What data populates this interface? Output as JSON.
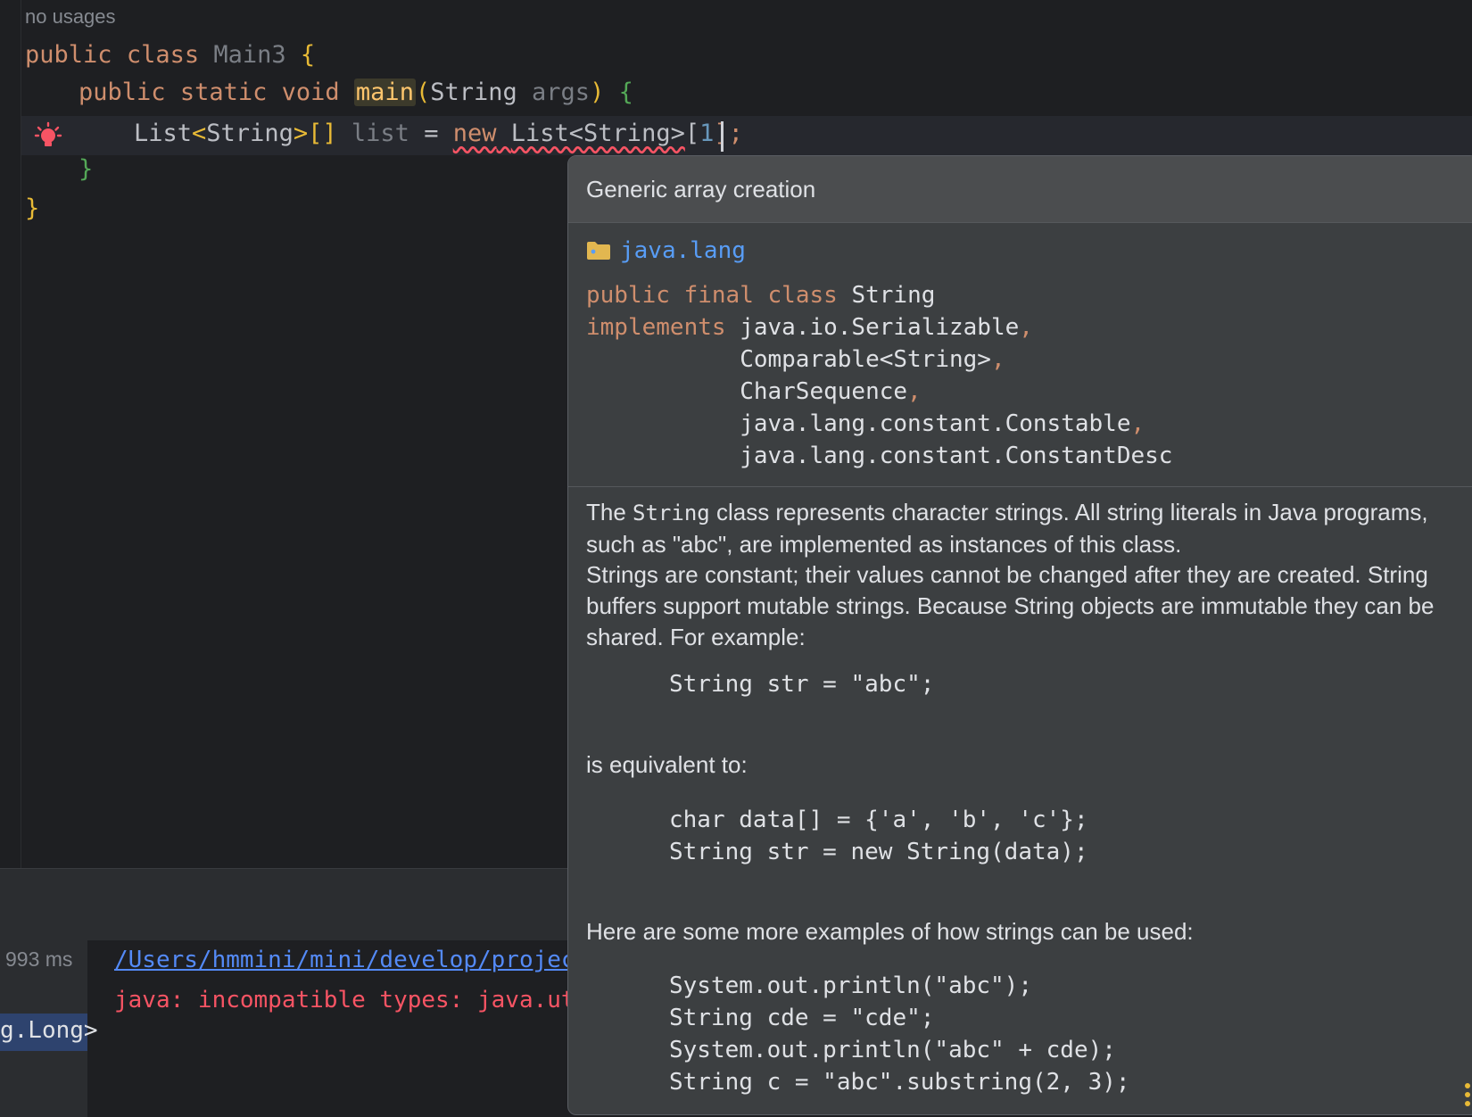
{
  "editor": {
    "usage_hint": "no usages",
    "line1": {
      "kw_public": "public",
      "kw_class": "class",
      "class_name": "Main3",
      "brace": "{"
    },
    "line2": {
      "kw_public": "public",
      "kw_static": "static",
      "kw_void": "void",
      "method": "main",
      "paren_open": "(",
      "param_type": "String",
      "param_name": "args",
      "paren_close": ")",
      "brace": "{"
    },
    "line3": {
      "decl_type": "List",
      "lt": "<",
      "generic": "String",
      "gt_arr": ">[]",
      "var_name": "list",
      "assign": "=",
      "kw_new": "new",
      "ctor_type": "List<String>",
      "bracket_open": "[",
      "size": "1",
      "bracket_close": "];"
    },
    "line4": {
      "brace": "}"
    },
    "line5": {
      "brace": "}"
    }
  },
  "popup": {
    "title": "Generic array creation",
    "package": "java.lang",
    "signature": {
      "kw_public": "public",
      "kw_final": "final",
      "kw_class": "class",
      "class_name": "String",
      "kw_implements": "implements",
      "interfaces": [
        "java.io.Serializable",
        "Comparable<String>",
        "CharSequence",
        "java.lang.constant.Constable",
        "java.lang.constant.ConstantDesc"
      ]
    },
    "doc": {
      "p1_before": "The ",
      "p1_code": "String",
      "p1_after": " class represents character strings. All string literals in Java programs, such as \"abc\", are implemented as instances of this class.",
      "p2": "Strings are constant; their values cannot be changed after they are created. String buffers support mutable strings. Because String objects are immutable they can be shared. For example:",
      "example1": "String str = \"abc\";",
      "equiv": "is equivalent to:",
      "example2_line1": "char data[] = {'a', 'b', 'c'};",
      "example2_line2": "String str = new String(data);",
      "more": "Here are some more examples of how strings can be used:",
      "example3": [
        "System.out.println(\"abc\");",
        "String cde = \"cde\";",
        "System.out.println(\"abc\" + cde);",
        "String c = \"abc\".substring(2, 3);"
      ]
    }
  },
  "bottom_panel": {
    "duration": "993 ms",
    "path_link": "/Users/hmmini/mini/develop/projec",
    "error": "java: incompatible types: java.ut",
    "selected_item": "g.Long>"
  },
  "colors": {
    "editor_bg": "#1e1f22",
    "keyword": "#cf8e6d",
    "popup_bg": "#3c3f41",
    "link": "#548af7",
    "error": "#f75464",
    "package": "#589df6"
  }
}
